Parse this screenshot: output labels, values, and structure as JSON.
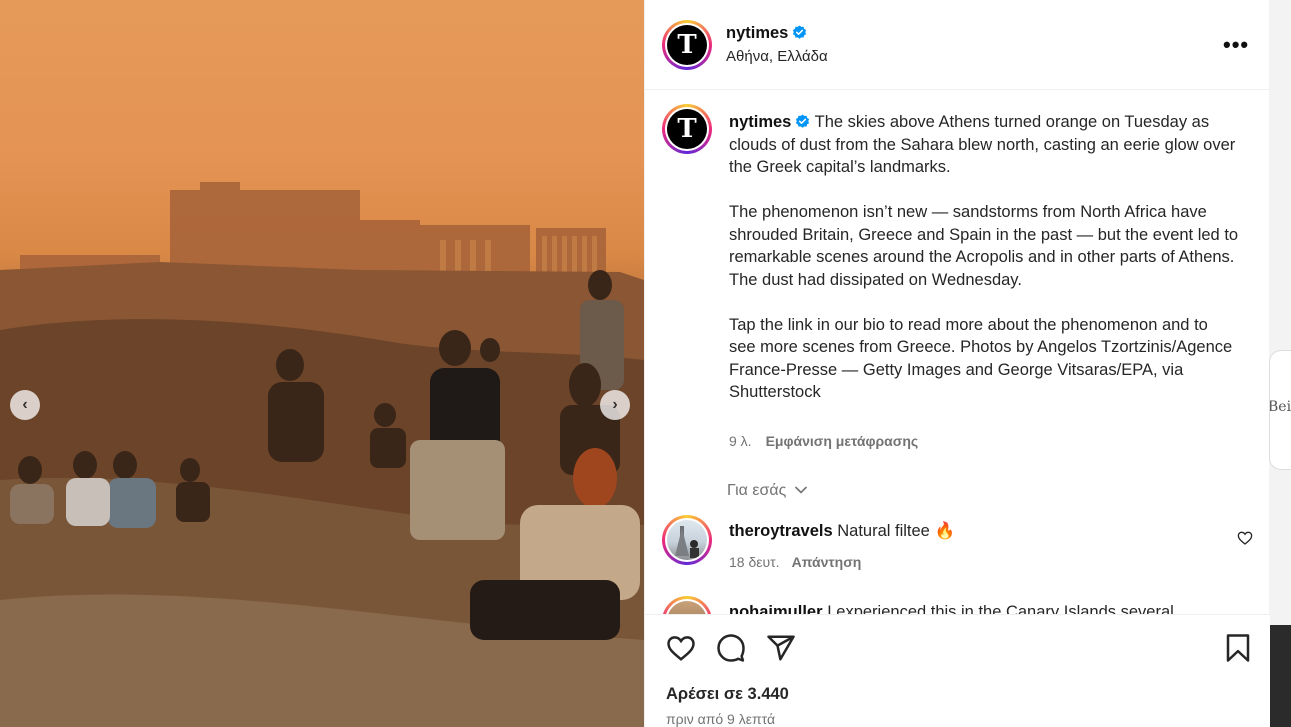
{
  "post": {
    "username": "nytimes",
    "location": "Αθήνα, Ελλάδα",
    "avatar_letter": "T",
    "more_icon": "more-horizontal-icon"
  },
  "caption": {
    "username": "nytimes",
    "paragraph1": "The skies above Athens turned orange on Tuesday as clouds of dust from the Sahara blew north, casting an eerie glow over the Greek capital’s landmarks.",
    "paragraph2": "The phenomenon isn’t new — sandstorms from North Africa have shrouded Britain, Greece and Spain in the past — but the event led to remarkable scenes around the Acropolis and in other parts of Athens.",
    "paragraph3": "The dust had dissipated on Wednesday.",
    "paragraph4": "Tap the link in our bio to read more about the phenomenon and to see more scenes from Greece. Photos by Angelos Tzortzinis/Agence France-Presse — Getty Images and George Vitsaras/EPA, via Shutterstock",
    "age": "9 λ.",
    "translate_label": "Εμφάνιση μετάφρασης"
  },
  "comments_filter": {
    "label": "Για εσάς"
  },
  "comments": [
    {
      "username": "theroytravels",
      "text": "Natural filtee 🔥",
      "age": "18 δευτ.",
      "reply_label": "Απάντηση"
    },
    {
      "username": "nohaimuller",
      "text": "I experienced this in the Canary Islands several"
    }
  ],
  "actions": {
    "likes": "Αρέσει σε 3.440",
    "time_ago": "πριν από 9 λεπτά"
  },
  "carousel": {
    "prev_icon": "chevron-left-icon",
    "next_icon": "chevron-right-icon"
  },
  "background": {
    "peek_text": "Bein"
  },
  "colors": {
    "verified": "#0095f6",
    "sky": "#e59a5a"
  }
}
